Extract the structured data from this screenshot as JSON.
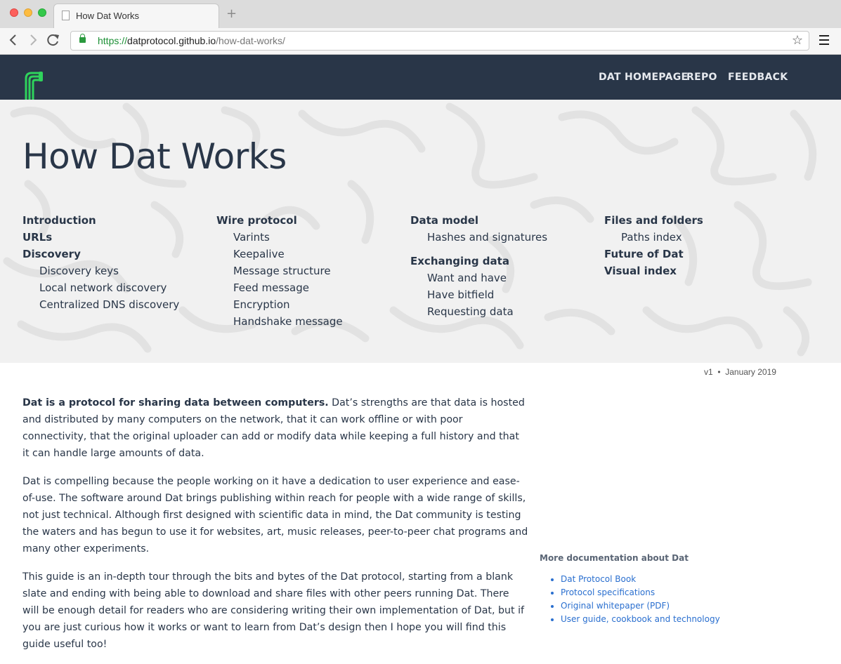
{
  "browser": {
    "tab_title": "How Dat Works",
    "new_tab": "+",
    "url_scheme": "https://",
    "url_host": "datprotocol.github.io",
    "url_path": "/how-dat-works/"
  },
  "header": {
    "nav": [
      "DAT HOMEPAGE",
      "REPO",
      "FEEDBACK"
    ]
  },
  "hero": {
    "title": "How Dat Works",
    "toc": [
      [
        {
          "label": "Introduction",
          "level": 1
        },
        {
          "label": "URLs",
          "level": 1
        },
        {
          "label": "Discovery",
          "level": 1
        },
        {
          "label": "Discovery keys",
          "level": 2
        },
        {
          "label": "Local network discovery",
          "level": 2
        },
        {
          "label": "Centralized DNS discovery",
          "level": 2
        }
      ],
      [
        {
          "label": "Wire protocol",
          "level": 1
        },
        {
          "label": "Varints",
          "level": 2
        },
        {
          "label": "Keepalive",
          "level": 2
        },
        {
          "label": "Message structure",
          "level": 2
        },
        {
          "label": "Feed message",
          "level": 2
        },
        {
          "label": "Encryption",
          "level": 2
        },
        {
          "label": "Handshake message",
          "level": 2
        }
      ],
      [
        {
          "label": "Data model",
          "level": 1
        },
        {
          "label": "Hashes and signatures",
          "level": 2
        },
        {
          "label": "Exchanging data",
          "level": 1
        },
        {
          "label": "Want and have",
          "level": 2
        },
        {
          "label": "Have bitfield",
          "level": 2
        },
        {
          "label": "Requesting data",
          "level": 2
        }
      ],
      [
        {
          "label": "Files and folders",
          "level": 1
        },
        {
          "label": "Paths index",
          "level": 2
        },
        {
          "label": "Future of Dat",
          "level": 1
        },
        {
          "label": "Visual index",
          "level": 1
        }
      ]
    ]
  },
  "meta": {
    "version": "v1",
    "separator": "•",
    "date": "January 2019"
  },
  "content": {
    "p1_bold": "Dat is a protocol for sharing data between computers.",
    "p1_rest": " Dat’s strengths are that data is hosted and distributed by many computers on the network, that it can work offline or with poor connectivity, that the original uploader can add or modify data while keeping a full history and that it can handle large amounts of data.",
    "p2": "Dat is compelling because the people working on it have a dedication to user experience and ease-of-use. The software around Dat brings publishing within reach for people with a wide range of skills, not just technical. Although first designed with scientific data in mind, the Dat community is testing the waters and has begun to use it for websites, art, music releases, peer-to-peer chat programs and many other experiments.",
    "p3": "This guide is an in-depth tour through the bits and bytes of the Dat protocol, starting from a blank slate and ending with being able to download and share files with other peers running Dat. There will be enough detail for readers who are considering writing their own implementation of Dat, but if you are just curious how it works or want to learn from Dat’s design then I hope you will find this guide useful too!"
  },
  "aside": {
    "title": "More documentation about Dat",
    "links": [
      "Dat Protocol Book",
      "Protocol specifications",
      "Original whitepaper (PDF)",
      "User guide, cookbook and technology"
    ]
  },
  "colors": {
    "header_bg": "#293648",
    "text": "#293648",
    "link": "#2a6fcf",
    "logo_green": "#2fd35c"
  }
}
